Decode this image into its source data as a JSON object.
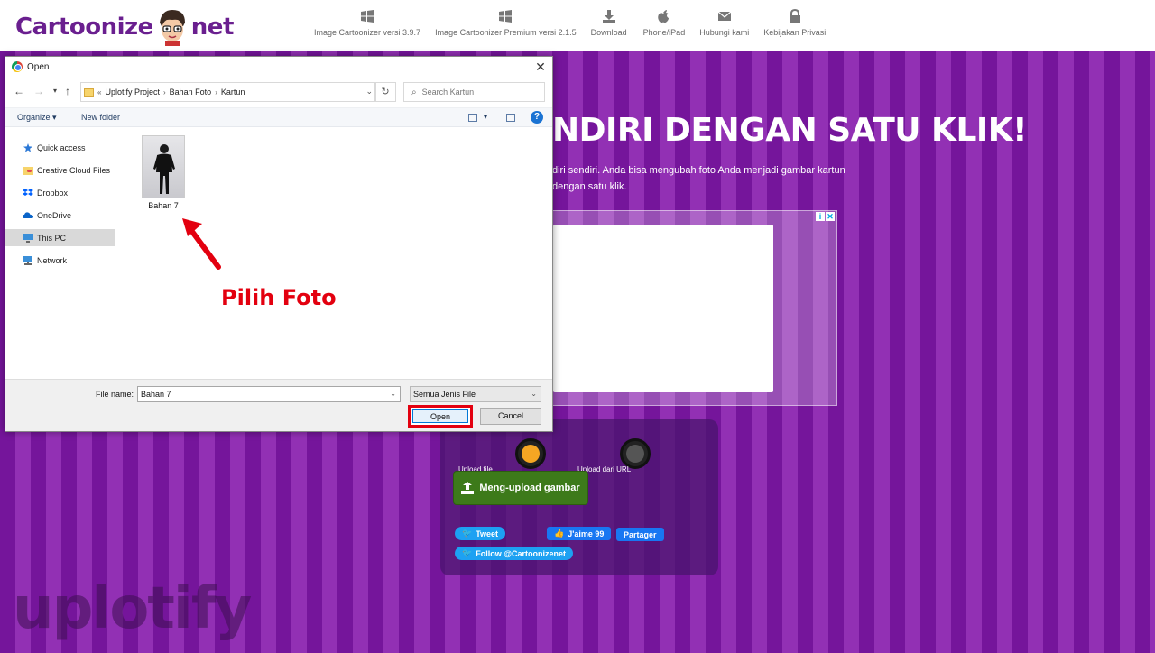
{
  "site": {
    "logo_left": "Cartoonize",
    "logo_right": "net",
    "nav": [
      {
        "label": "Image Cartoonizer versi 3.9.7",
        "icon": "windows-icon"
      },
      {
        "label": "Image Cartoonizer Premium versi 2.1.5",
        "icon": "windows-icon"
      },
      {
        "label": "Download",
        "icon": "download-icon"
      },
      {
        "label": "iPhone/iPad",
        "icon": "apple-icon"
      },
      {
        "label": "Hubungi kami",
        "icon": "mail-icon"
      },
      {
        "label": "Kebijakan Privasi",
        "icon": "lock-icon"
      }
    ],
    "hero_title": "NDIRI DENGAN SATU KLIK!",
    "hero_sub_1": "diri sendiri. Anda bisa mengubah foto Anda menjadi gambar kartun",
    "hero_sub_2": "dengan satu klik.",
    "options": {
      "left": "Upload file",
      "right": "Upload dari URL"
    },
    "upload_button": "Meng-upload gambar",
    "social": {
      "tweet": "Tweet",
      "like": "J'aime 99",
      "share": "Partager",
      "follow": "Follow @Cartoonizenet"
    }
  },
  "dialog": {
    "title": "Open",
    "close": "✕",
    "breadcrumb": [
      "Uplotify Project",
      "Bahan Foto",
      "Kartun"
    ],
    "breadcrumb_prefix": "«",
    "search_placeholder": "Search Kartun",
    "toolbar": {
      "organize": "Organize ▾",
      "new_folder": "New folder",
      "help": "?"
    },
    "sidebar": [
      {
        "label": "Quick access",
        "icon": "star-icon",
        "selected": false
      },
      {
        "label": "Creative Cloud Files",
        "icon": "cloud-folder-icon",
        "selected": false
      },
      {
        "label": "Dropbox",
        "icon": "dropbox-icon",
        "selected": false
      },
      {
        "label": "OneDrive",
        "icon": "onedrive-icon",
        "selected": false
      },
      {
        "label": "This PC",
        "icon": "computer-icon",
        "selected": true
      },
      {
        "label": "Network",
        "icon": "network-icon",
        "selected": false
      }
    ],
    "files": [
      {
        "name": "Bahan 7"
      }
    ],
    "file_name_label": "File name:",
    "file_name_value": "Bahan 7",
    "file_type": "Semua Jenis File",
    "open_button": "Open",
    "cancel_button": "Cancel"
  },
  "annotation": {
    "text": "Pilih Foto",
    "color": "#e3000f"
  },
  "watermark": "uplotify",
  "colors": {
    "purple_dark": "#75159b",
    "purple_light": "#9230b4",
    "logo": "#6a1f8f",
    "upload_green": "#3d7a1a"
  }
}
